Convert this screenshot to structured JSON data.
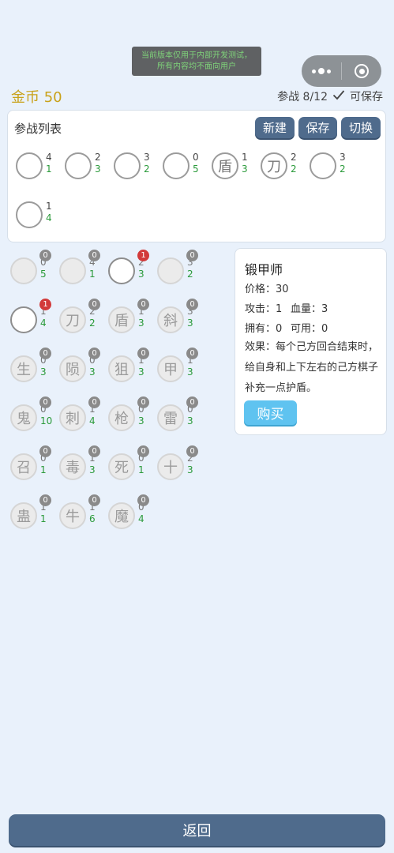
{
  "banner": {
    "line1": "当前版本仅用于内部开发测试，",
    "line2": "所有内容均不面向用户"
  },
  "header": {
    "gold": "金币 50",
    "status": "参战 8/12",
    "save_state": "可保存"
  },
  "lineup": {
    "title": "参战列表",
    "buttons": {
      "new": "新建",
      "save": "保存",
      "switch": "切换"
    },
    "pieces": [
      {
        "glyph": "",
        "atk": "4",
        "hp": "1"
      },
      {
        "glyph": "",
        "atk": "2",
        "hp": "3"
      },
      {
        "glyph": "",
        "atk": "3",
        "hp": "2"
      },
      {
        "glyph": "",
        "atk": "0",
        "hp": "5"
      },
      {
        "glyph": "盾",
        "atk": "1",
        "hp": "3"
      },
      {
        "glyph": "刀",
        "atk": "2",
        "hp": "2"
      },
      {
        "glyph": "",
        "atk": "3",
        "hp": "2"
      },
      {
        "glyph": "",
        "atk": "1",
        "hp": "4"
      }
    ]
  },
  "shop": {
    "pieces": [
      {
        "glyph": "",
        "atk": "0",
        "hp": "5",
        "count": "0"
      },
      {
        "glyph": "",
        "atk": "4",
        "hp": "1",
        "count": "0"
      },
      {
        "glyph": "",
        "atk": "2",
        "hp": "3",
        "count": "1"
      },
      {
        "glyph": "",
        "atk": "3",
        "hp": "2",
        "count": "0"
      },
      {
        "glyph": "",
        "atk": "1",
        "hp": "4",
        "count": "1"
      },
      {
        "glyph": "刀",
        "atk": "2",
        "hp": "2",
        "count": "0"
      },
      {
        "glyph": "盾",
        "atk": "1",
        "hp": "3",
        "count": "0"
      },
      {
        "glyph": "斜",
        "atk": "3",
        "hp": "3",
        "count": "0"
      },
      {
        "glyph": "生",
        "atk": "0",
        "hp": "3",
        "count": "0"
      },
      {
        "glyph": "陨",
        "atk": "0",
        "hp": "3",
        "count": "0"
      },
      {
        "glyph": "狙",
        "atk": "1",
        "hp": "3",
        "count": "0"
      },
      {
        "glyph": "甲",
        "atk": "1",
        "hp": "3",
        "count": "0"
      },
      {
        "glyph": "鬼",
        "atk": "0",
        "hp": "10",
        "count": "0"
      },
      {
        "glyph": "刺",
        "atk": "1",
        "hp": "4",
        "count": "0"
      },
      {
        "glyph": "枪",
        "atk": "0",
        "hp": "3",
        "count": "0"
      },
      {
        "glyph": "雷",
        "atk": "0",
        "hp": "3",
        "count": "0"
      },
      {
        "glyph": "召",
        "atk": "0",
        "hp": "1",
        "count": "0"
      },
      {
        "glyph": "毒",
        "atk": "1",
        "hp": "3",
        "count": "0"
      },
      {
        "glyph": "死",
        "atk": "0",
        "hp": "1",
        "count": "0"
      },
      {
        "glyph": "十",
        "atk": "2",
        "hp": "3",
        "count": "0"
      },
      {
        "glyph": "蛊",
        "atk": "1",
        "hp": "1",
        "count": "0"
      },
      {
        "glyph": "牛",
        "atk": "1",
        "hp": "6",
        "count": "0"
      },
      {
        "glyph": "魔",
        "atk": "0",
        "hp": "4",
        "count": "0"
      }
    ]
  },
  "detail": {
    "name": "锻甲师",
    "price": "价格：30",
    "attack": "攻击：1",
    "health": "血量：3",
    "owned": "拥有：0",
    "available": "可用：0",
    "effect": "效果：每个己方回合结束时，给自身和上下左右的己方棋子补充一点护盾。",
    "buy_label": "购买"
  },
  "footer": {
    "back_label": "返回"
  },
  "colors": {
    "primary": "#4f6b8c",
    "gold": "#c9a21a",
    "hp_green": "#2a9a3a",
    "badge_red": "#d23a3a",
    "buy": "#5fc3f0"
  }
}
